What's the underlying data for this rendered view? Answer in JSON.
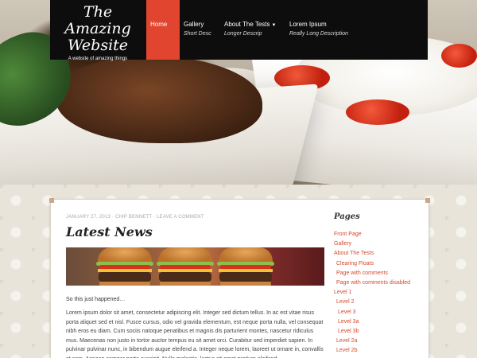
{
  "site": {
    "title_line1": "The",
    "title_line2": "Amazing",
    "title_line3": "Website",
    "tagline": "A website of amazing things"
  },
  "nav": [
    {
      "label": "Home",
      "desc": ""
    },
    {
      "label": "Gallery",
      "desc": "Short Desc"
    },
    {
      "label": "About The Tests",
      "desc": "Longer Descrip"
    },
    {
      "label": "Lorem Ipsum",
      "desc": "Really Long Description"
    }
  ],
  "post": {
    "date": "JANUARY 27, 2013",
    "author": "CHIP BENNETT",
    "comments": "LEAVE A COMMENT",
    "separator": "·",
    "title": "Latest News",
    "intro": "So this just happened…",
    "body": "Lorem ipsum dolor sit amet, consectetur adipiscing elit. Integer sed dictum tellus. In ac est vitae risus porta aliquet sed et nisl. Fusce cursus, odio vel gravida elementum, est neque porta nulla, vel consequat nibh eros eu diam. Cum sociis natoque penatibus et magnis dis parturient montes, nascetur ridiculus mus. Maecenas non justo in tortor auctor tempus eu sit amet orci. Curabitur sed imperdiet sapien. In pulvinar pulvinar nunc, in bibendum augue eleifend a. Integer neque lorem, laoreet ut ornare in, convallis at sem. Aenean semper porta suscipit. Nulla molestie, lectus sit amet pretium eleifend,"
  },
  "sidebar": {
    "title": "Pages",
    "items": [
      {
        "label": "Front Page",
        "level": 0
      },
      {
        "label": "Gallery",
        "level": 0
      },
      {
        "label": "About The Tests",
        "level": 0
      },
      {
        "label": "Clearing Floats",
        "level": 1
      },
      {
        "label": "Page with comments",
        "level": 1
      },
      {
        "label": "Page with comments disabled",
        "level": 1
      },
      {
        "label": "Level 1",
        "level": 0
      },
      {
        "label": "Level 2",
        "level": 1
      },
      {
        "label": "Level 3",
        "level": 2
      },
      {
        "label": "Level 3a",
        "level": 2
      },
      {
        "label": "Level 3b",
        "level": 2
      },
      {
        "label": "Level 2a",
        "level": 1
      },
      {
        "label": "Level 2b",
        "level": 1
      }
    ]
  },
  "colors": {
    "accent": "#e2452f",
    "link": "#d44a2d",
    "header_bg": "#0d0d0d"
  }
}
